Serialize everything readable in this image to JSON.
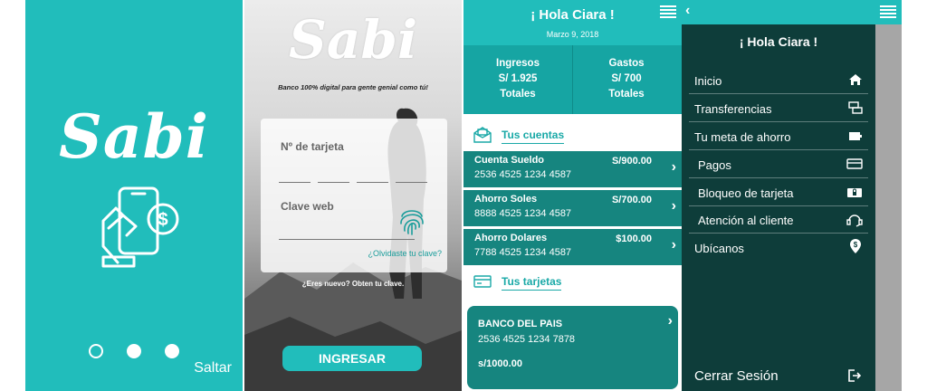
{
  "splash": {
    "logo": "Sabi",
    "skip_label": "Saltar"
  },
  "login": {
    "logo": "Sabi",
    "tagline": "Banco 100% digital para gente genial como tú!",
    "card_label": "Nº de tarjeta",
    "password_label": "Clave web",
    "forgot_link": "¿Olvidaste tu clave?",
    "new_user_link": "¿Eres nuevo? Obten tu clave.",
    "login_button": "INGRESAR"
  },
  "dashboard": {
    "greeting": "¡ Hola Ciara !",
    "date": "Marzo 9, 2018",
    "income": {
      "label": "Ingresos",
      "value": "S/ 1.925",
      "sub": "Totales"
    },
    "expenses": {
      "label": "Gastos",
      "value": "S/ 700",
      "sub": "Totales"
    },
    "accounts_title": "Tus cuentas",
    "accounts": [
      {
        "name": "Cuenta Sueldo",
        "number": "2536 4525 1234 4587",
        "amount": "S/900.00"
      },
      {
        "name": "Ahorro Soles",
        "number": "8888 4525 1234 4587",
        "amount": "S/700.00"
      },
      {
        "name": "Ahorro Dolares",
        "number": "7788 4525 1234 4587",
        "amount": "$100.00"
      }
    ],
    "cards_title": "Tus tarjetas",
    "card": {
      "bank": "BANCO DEL PAIS",
      "number": "2536 4525 1234 7878",
      "amount": "s/1000.00"
    }
  },
  "menu": {
    "greeting": "¡ Hola Ciara !",
    "items": [
      {
        "label": "Inicio",
        "icon": "home-icon"
      },
      {
        "label": "Transferencias",
        "icon": "transfer-icon"
      },
      {
        "label": "Tu meta de ahorro",
        "icon": "wallet-icon"
      },
      {
        "label": "Pagos",
        "icon": "credit-card-icon"
      },
      {
        "label": "Bloqueo de tarjeta",
        "icon": "card-lock-icon"
      },
      {
        "label": "Atención al cliente",
        "icon": "support-icon"
      },
      {
        "label": "Ubícanos",
        "icon": "location-pin-icon"
      }
    ],
    "logout": "Cerrar Sesión"
  },
  "colors": {
    "primary": "#21bdbb",
    "dark": "#16857f",
    "menu_bg": "#0e3d3a"
  }
}
